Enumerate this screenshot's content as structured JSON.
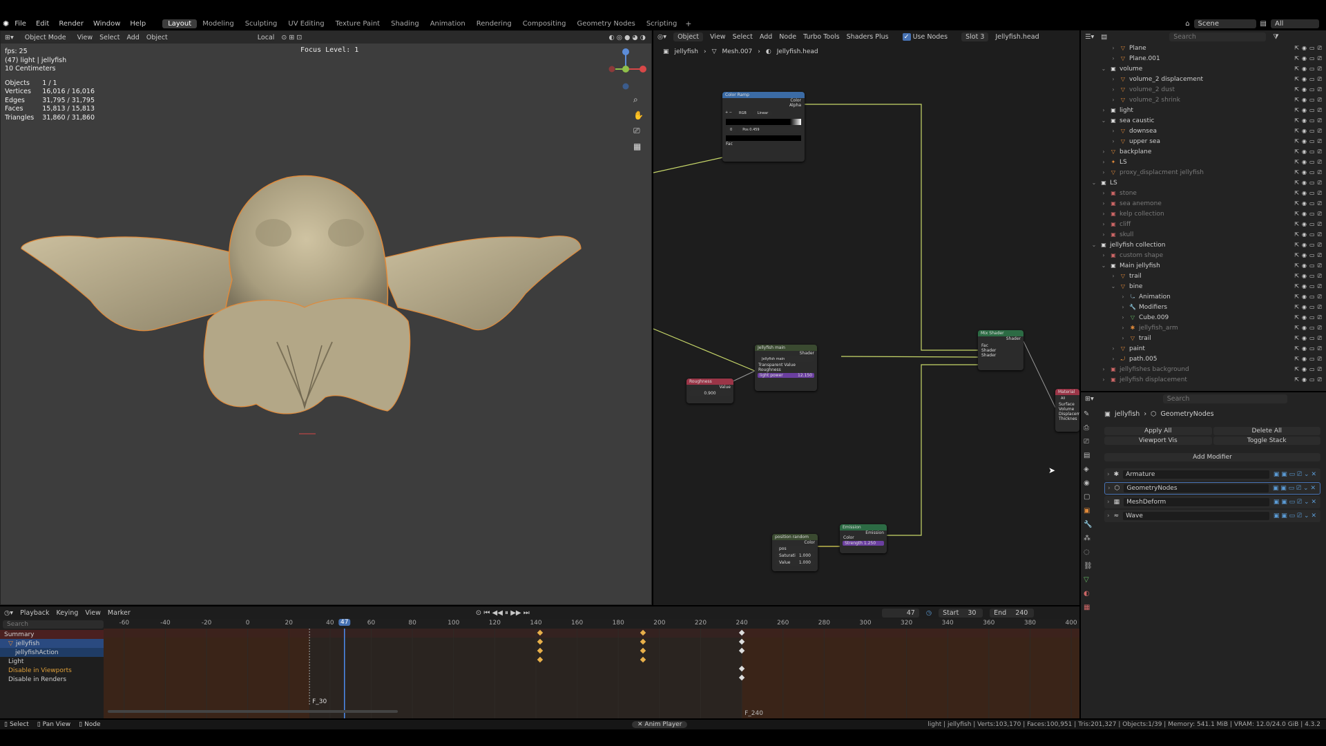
{
  "menus": [
    "File",
    "Edit",
    "Render",
    "Window",
    "Help"
  ],
  "workspaces": [
    {
      "label": "Layout",
      "active": true
    },
    {
      "label": "Modeling"
    },
    {
      "label": "Sculpting"
    },
    {
      "label": "UV Editing"
    },
    {
      "label": "Texture Paint"
    },
    {
      "label": "Shading"
    },
    {
      "label": "Animation"
    },
    {
      "label": "Rendering"
    },
    {
      "label": "Compositing"
    },
    {
      "label": "Geometry Nodes"
    },
    {
      "label": "Scripting"
    }
  ],
  "top_right": {
    "scene": "Scene",
    "layer": "All"
  },
  "viewport": {
    "mode": "Object Mode",
    "menu": [
      "View",
      "Select",
      "Add",
      "Object"
    ],
    "orientation": "Local",
    "focus": "Focus Level: 1",
    "stats": {
      "fps": "fps: 25",
      "object_name": "(47) light | jellyfish",
      "scale": "10 Centimeters",
      "rows": [
        [
          "Objects",
          "1 / 1"
        ],
        [
          "Vertices",
          "16,016 / 16,016"
        ],
        [
          "Edges",
          "31,795 / 31,795"
        ],
        [
          "Faces",
          "15,813 / 15,813"
        ],
        [
          "Triangles",
          "31,860 / 31,860"
        ]
      ]
    }
  },
  "node_editor": {
    "type": "Object",
    "menu": [
      "View",
      "Select",
      "Add",
      "Node",
      "Turbo Tools",
      "Shaders Plus"
    ],
    "use_nodes": "Use Nodes",
    "slot": "Slot 3",
    "material": "Jellyfish.head",
    "breadcrumb": [
      "jellyfish",
      "Mesh.007",
      "Jellyfish.head"
    ],
    "nodes": {
      "color_ramp": "Color Ramp",
      "ramp_mode": "RGB",
      "ramp_interp": "Linear",
      "ramp_pos": "Pos",
      "ramp_pos_val": "0.459",
      "ramp_idx": "0",
      "out_color": "Color",
      "out_alpha": "Alpha",
      "in_fac": "Fac",
      "mix": "Mix Shader",
      "mix_out": "Shader",
      "mix_fac": "Fac",
      "mix_sh1": "Shader",
      "mix_sh2": "Shader",
      "jelly": "Jellyfish main",
      "jelly_field": "Jellyfish main",
      "jelly_out": "Shader",
      "jelly_tv": "Transparent Value",
      "jelly_rough": "Roughness",
      "jelly_light": "light power",
      "jelly_light_val": "12.150",
      "rough": "Roughness",
      "rough_val": "Value",
      "rough_num": "0.900",
      "emission": "Emission",
      "em_out": "Emission",
      "em_color": "Color",
      "em_strength": "Strength",
      "em_strength_val": "1.250",
      "pos": "position random",
      "pos_out": "Color",
      "pos_field": "pos",
      "pos_sat": "Saturati",
      "pos_sat_val": "1.000",
      "pos_val": "Value",
      "pos_val_val": "1.000",
      "mat": "Material",
      "mat_all": "All",
      "mat_surface": "Surface",
      "mat_volume": "Volume",
      "mat_disp": "Displacem",
      "mat_thick": "Thicknes"
    }
  },
  "outliner": {
    "search": "Search",
    "rows": [
      {
        "l": "Plane",
        "d": 1,
        "i": "▽",
        "c": "#e08a3a"
      },
      {
        "l": "Plane.001",
        "d": 1,
        "i": "▽",
        "c": "#e08a3a"
      },
      {
        "l": "volume",
        "d": 0,
        "i": "▣",
        "c": "#ddd",
        "ex": true
      },
      {
        "l": "volume_2 displacement",
        "d": 1,
        "i": "▽",
        "c": "#e08a3a"
      },
      {
        "l": "volume_2 dust",
        "d": 1,
        "i": "▽",
        "c": "#e08a3a",
        "dim": true
      },
      {
        "l": "volume_2 shrink",
        "d": 1,
        "i": "▽",
        "c": "#e08a3a",
        "dim": true
      },
      {
        "l": "light",
        "d": 0,
        "i": "▣",
        "c": "#ddd"
      },
      {
        "l": "sea caustic",
        "d": 0,
        "i": "▣",
        "c": "#ddd",
        "ex": true
      },
      {
        "l": "downsea",
        "d": 1,
        "i": "▽",
        "c": "#e08a3a"
      },
      {
        "l": "upper sea",
        "d": 1,
        "i": "▽",
        "c": "#e08a3a"
      },
      {
        "l": "backplane",
        "d": 0,
        "i": "▽",
        "c": "#e08a3a"
      },
      {
        "l": "LS",
        "d": 0,
        "i": "✦",
        "c": "#e08a3a"
      },
      {
        "l": "proxy_displacment jellyfish",
        "d": 0,
        "i": "▽",
        "c": "#e08a3a",
        "dim": true
      },
      {
        "l": "LS",
        "d": -1,
        "i": "▣",
        "c": "#ddd",
        "ex": true
      },
      {
        "l": "stone",
        "d": 0,
        "i": "▣",
        "c": "#c66",
        "dim": true
      },
      {
        "l": "sea anemone",
        "d": 0,
        "i": "▣",
        "c": "#c66",
        "dim": true
      },
      {
        "l": "kelp collection",
        "d": 0,
        "i": "▣",
        "c": "#c66",
        "dim": true
      },
      {
        "l": "cliff",
        "d": 0,
        "i": "▣",
        "c": "#c66",
        "dim": true
      },
      {
        "l": "skull",
        "d": 0,
        "i": "▣",
        "c": "#c66",
        "dim": true
      },
      {
        "l": "jellyfish collection",
        "d": -1,
        "i": "▣",
        "c": "#ddd",
        "ex": true
      },
      {
        "l": "custom shape",
        "d": 0,
        "i": "▣",
        "c": "#c66",
        "dim": true
      },
      {
        "l": "Main jellyfish",
        "d": 0,
        "i": "▣",
        "c": "#ddd",
        "ex": true
      },
      {
        "l": "trail",
        "d": 1,
        "i": "▽",
        "c": "#e08a3a"
      },
      {
        "l": "bine",
        "d": 1,
        "i": "▽",
        "c": "#e08a3a",
        "ex": true
      },
      {
        "l": "Animation",
        "d": 2,
        "i": "⤿",
        "c": "#8ab"
      },
      {
        "l": "Modifiers",
        "d": 2,
        "i": "🔧",
        "c": "#8ab"
      },
      {
        "l": "Cube.009",
        "d": 2,
        "i": "▽",
        "c": "#6b6"
      },
      {
        "l": "jellyfish_arm",
        "d": 2,
        "i": "✱",
        "c": "#e08a3a",
        "dim": true
      },
      {
        "l": "trail",
        "d": 2,
        "i": "▽",
        "c": "#e08a3a"
      },
      {
        "l": "paint",
        "d": 1,
        "i": "▽",
        "c": "#e08a3a"
      },
      {
        "l": "path.005",
        "d": 1,
        "i": "⤾",
        "c": "#e08a3a"
      },
      {
        "l": "jellyfishes background",
        "d": 0,
        "i": "▣",
        "c": "#c66",
        "dim": true
      },
      {
        "l": "jellyfish displacement",
        "d": 0,
        "i": "▣",
        "c": "#c66",
        "dim": true
      }
    ]
  },
  "properties": {
    "search": "Search",
    "breadcrumb": [
      "jellyfish",
      "GeometryNodes"
    ],
    "apply_all": "Apply All",
    "delete_all": "Delete All",
    "viewport_vis": "Viewport Vis",
    "toggle_stack": "Toggle Stack",
    "add_modifier": "Add Modifier",
    "modifiers": [
      {
        "name": "Armature",
        "icon": "✱"
      },
      {
        "name": "GeometryNodes",
        "icon": "⬡"
      },
      {
        "name": "MeshDeform",
        "icon": "▦"
      },
      {
        "name": "Wave",
        "icon": "≈"
      }
    ]
  },
  "timeline": {
    "menu": [
      "Playback",
      "Keying",
      "View",
      "Marker"
    ],
    "current": "47",
    "start_label": "Start",
    "start": "30",
    "end_label": "End",
    "end": "240",
    "search": "Search",
    "ticks": [
      "-60",
      "-40",
      "-20",
      "0",
      "20",
      "40",
      "60",
      "80",
      "100",
      "120",
      "140",
      "160",
      "180",
      "200",
      "220",
      "240",
      "260",
      "280",
      "300",
      "320",
      "340",
      "360",
      "380",
      "400"
    ],
    "channels": [
      "Summary",
      "jellyfish",
      "jellyfishAction",
      "Light",
      "Disable in Viewports",
      "Disable in Renders"
    ],
    "markers": [
      "F_30",
      "F_240"
    ]
  },
  "status": {
    "select": "Select",
    "pan": "Pan View",
    "node": "Node",
    "center": "Anim Player",
    "info": "light | jellyfish | Verts:103,170 | Faces:100,951 | Tris:201,327 | Objects:1/39 | Memory: 541.1 MiB | VRAM: 12.0/24.0 GiB | 4.3.2"
  }
}
